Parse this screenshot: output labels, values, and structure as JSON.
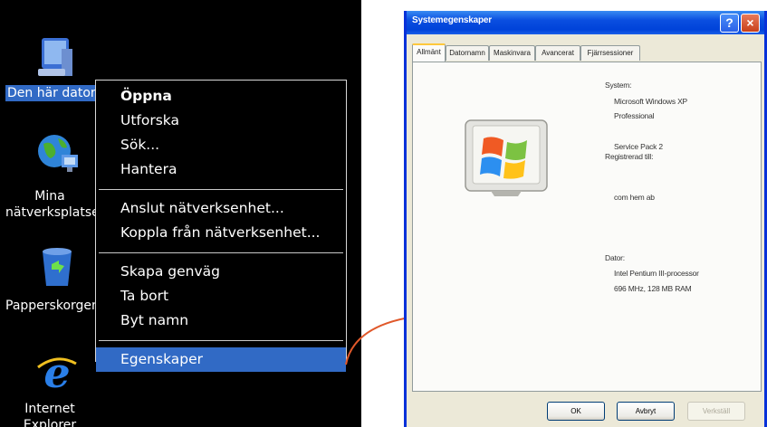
{
  "desktop": {
    "icons": [
      {
        "name": "my-computer",
        "label": "Den här datorn"
      },
      {
        "name": "network-places",
        "label_line1": "Mina",
        "label_line2": "nätverksplatser"
      },
      {
        "name": "recycle-bin",
        "label": "Papperskorgen"
      },
      {
        "name": "internet-explorer",
        "label_line1": "Internet",
        "label_line2": "Explorer"
      }
    ]
  },
  "context_menu": {
    "items": [
      {
        "label": "Öppna"
      },
      {
        "label": "Utforska"
      },
      {
        "label": "Sök..."
      },
      {
        "label": "Hantera"
      },
      {
        "label": "Anslut nätverksenhet..."
      },
      {
        "label": "Koppla från nätverksenhet..."
      },
      {
        "label": "Skapa genväg"
      },
      {
        "label": "Ta bort"
      },
      {
        "label": "Byt namn"
      },
      {
        "label": "Egenskaper"
      }
    ]
  },
  "dialog": {
    "title": "Systemegenskaper",
    "tabs": [
      "Allmänt",
      "Datornamn",
      "Maskinvara",
      "Avancerat",
      "Fjärrsessioner"
    ],
    "system_label": "System:",
    "os_name": "Microsoft Windows XP",
    "os_edition": "Professional",
    "service_pack": "Service Pack 2",
    "registered_label": "Registrerad till:",
    "registered_to": "com hem ab",
    "computer_label": "Dator:",
    "cpu": "Intel Pentium III-processor",
    "cpu_ram": "696 MHz, 128 MB RAM",
    "buttons": {
      "ok": "OK",
      "cancel": "Avbryt",
      "apply": "Verkställ"
    }
  },
  "colors": {
    "selection": "#316ac5",
    "titlebar": "#0a4ee0",
    "arrow": "#e0582a",
    "dialog_bg": "#ece9d8"
  }
}
